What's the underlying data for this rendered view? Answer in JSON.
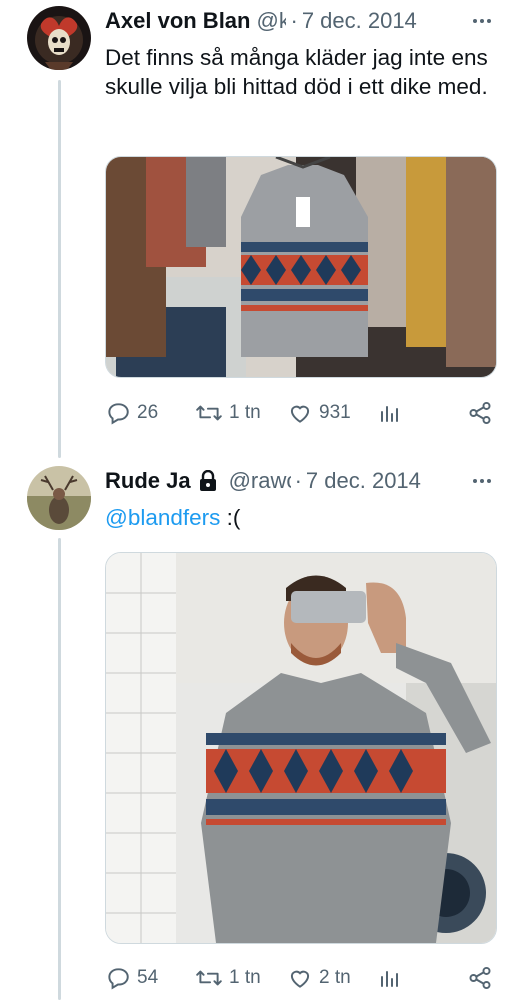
{
  "tweets": [
    {
      "author_name": "Axel von Blan",
      "author_handle": "@k",
      "date": "7 dec. 2014",
      "text": "Det finns så många kläder jag inte ens skulle vilja bli hittad död i ett dike med.",
      "stats": {
        "replies": "26",
        "retweets": "1 tn",
        "likes": "931"
      }
    },
    {
      "author_name": "Rude Ja",
      "author_handle": "@rawc",
      "date": "7 dec. 2014",
      "mention": "@blandfers",
      "text_after": " :(",
      "stats": {
        "replies": "54",
        "retweets": "1 tn",
        "likes": "2 tn"
      }
    }
  ],
  "separator": "·",
  "colors": {
    "accent": "#1d9bf0",
    "muted": "#536471",
    "text": "#0f1419"
  }
}
